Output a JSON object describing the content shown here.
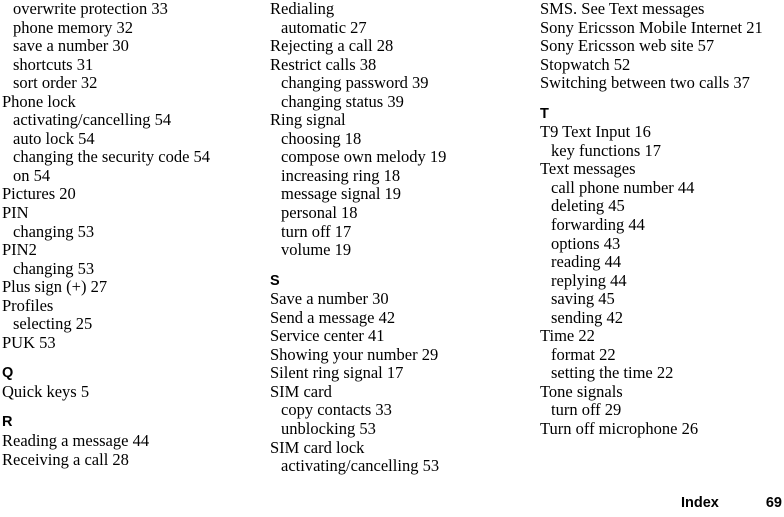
{
  "document": {
    "page_type": "index",
    "footer": {
      "label": "Index",
      "page_number": "69"
    },
    "text_color": "#000000",
    "background_color": "#ffffff"
  },
  "columns": [
    {
      "id": "column-1",
      "blocks": [
        {
          "kind": "entry",
          "level": 1,
          "text": "overwrite protection 33"
        },
        {
          "kind": "entry",
          "level": 1,
          "text": "phone memory 32"
        },
        {
          "kind": "entry",
          "level": 1,
          "text": "save a number 30"
        },
        {
          "kind": "entry",
          "level": 1,
          "text": "shortcuts 31"
        },
        {
          "kind": "entry",
          "level": 1,
          "text": "sort order 32"
        },
        {
          "kind": "entry",
          "level": 0,
          "text": "Phone lock"
        },
        {
          "kind": "entry",
          "level": 1,
          "text": "activating/cancelling 54"
        },
        {
          "kind": "entry",
          "level": 1,
          "text": "auto lock 54"
        },
        {
          "kind": "entry",
          "level": 1,
          "text": "changing the security code 54"
        },
        {
          "kind": "entry",
          "level": 1,
          "text": "on 54"
        },
        {
          "kind": "entry",
          "level": 0,
          "text": "Pictures 20"
        },
        {
          "kind": "entry",
          "level": 0,
          "text": "PIN"
        },
        {
          "kind": "entry",
          "level": 1,
          "text": "changing 53"
        },
        {
          "kind": "entry",
          "level": 0,
          "text": "PIN2"
        },
        {
          "kind": "entry",
          "level": 1,
          "text": "changing 53"
        },
        {
          "kind": "entry",
          "level": 0,
          "text": "Plus sign (+) 27"
        },
        {
          "kind": "entry",
          "level": 0,
          "text": "Profiles"
        },
        {
          "kind": "entry",
          "level": 1,
          "text": "selecting 25"
        },
        {
          "kind": "entry",
          "level": 0,
          "text": "PUK 53"
        },
        {
          "kind": "spacer"
        },
        {
          "kind": "heading",
          "text": "Q"
        },
        {
          "kind": "entry",
          "level": 0,
          "text": "Quick keys 5"
        },
        {
          "kind": "spacer"
        },
        {
          "kind": "heading",
          "text": "R"
        },
        {
          "kind": "entry",
          "level": 0,
          "text": "Reading a message 44"
        },
        {
          "kind": "entry",
          "level": 0,
          "text": "Receiving a call 28"
        }
      ]
    },
    {
      "id": "column-2",
      "blocks": [
        {
          "kind": "entry",
          "level": 0,
          "text": "Redialing"
        },
        {
          "kind": "entry",
          "level": 1,
          "text": "automatic 27"
        },
        {
          "kind": "entry",
          "level": 0,
          "text": "Rejecting a call 28"
        },
        {
          "kind": "entry",
          "level": 0,
          "text": "Restrict calls 38"
        },
        {
          "kind": "entry",
          "level": 1,
          "text": "changing password 39"
        },
        {
          "kind": "entry",
          "level": 1,
          "text": "changing status 39"
        },
        {
          "kind": "entry",
          "level": 0,
          "text": "Ring signal"
        },
        {
          "kind": "entry",
          "level": 1,
          "text": "choosing 18"
        },
        {
          "kind": "entry",
          "level": 1,
          "text": "compose own melody 19"
        },
        {
          "kind": "entry",
          "level": 1,
          "text": "increasing ring 18"
        },
        {
          "kind": "entry",
          "level": 1,
          "text": "message signal 19"
        },
        {
          "kind": "entry",
          "level": 1,
          "text": "personal 18"
        },
        {
          "kind": "entry",
          "level": 1,
          "text": "turn off 17"
        },
        {
          "kind": "entry",
          "level": 1,
          "text": "volume 19"
        },
        {
          "kind": "spacer"
        },
        {
          "kind": "heading",
          "text": "S"
        },
        {
          "kind": "entry",
          "level": 0,
          "text": "Save a number 30"
        },
        {
          "kind": "entry",
          "level": 0,
          "text": "Send a message 42"
        },
        {
          "kind": "entry",
          "level": 0,
          "text": "Service center 41"
        },
        {
          "kind": "entry",
          "level": 0,
          "text": "Showing your number 29"
        },
        {
          "kind": "entry",
          "level": 0,
          "text": "Silent ring signal 17"
        },
        {
          "kind": "entry",
          "level": 0,
          "text": "SIM card"
        },
        {
          "kind": "entry",
          "level": 1,
          "text": "copy contacts 33"
        },
        {
          "kind": "entry",
          "level": 1,
          "text": "unblocking 53"
        },
        {
          "kind": "entry",
          "level": 0,
          "text": "SIM card lock"
        },
        {
          "kind": "entry",
          "level": 1,
          "text": "activating/cancelling 53"
        }
      ]
    },
    {
      "id": "column-3",
      "blocks": [
        {
          "kind": "entry",
          "level": 0,
          "text": "SMS. See Text messages"
        },
        {
          "kind": "entry",
          "level": 0,
          "text": "Sony Ericsson Mobile Internet 21"
        },
        {
          "kind": "entry",
          "level": 0,
          "text": "Sony Ericsson web site 57"
        },
        {
          "kind": "entry",
          "level": 0,
          "text": "Stopwatch 52"
        },
        {
          "kind": "entry",
          "level": 0,
          "text": "Switching between two calls 37"
        },
        {
          "kind": "spacer"
        },
        {
          "kind": "heading",
          "text": "T"
        },
        {
          "kind": "entry",
          "level": 0,
          "text": "T9 Text Input 16"
        },
        {
          "kind": "entry",
          "level": 1,
          "text": "key functions 17"
        },
        {
          "kind": "entry",
          "level": 0,
          "text": "Text messages"
        },
        {
          "kind": "entry",
          "level": 1,
          "text": "call phone number 44"
        },
        {
          "kind": "entry",
          "level": 1,
          "text": "deleting 45"
        },
        {
          "kind": "entry",
          "level": 1,
          "text": "forwarding 44"
        },
        {
          "kind": "entry",
          "level": 1,
          "text": "options 43"
        },
        {
          "kind": "entry",
          "level": 1,
          "text": "reading 44"
        },
        {
          "kind": "entry",
          "level": 1,
          "text": "replying 44"
        },
        {
          "kind": "entry",
          "level": 1,
          "text": "saving 45"
        },
        {
          "kind": "entry",
          "level": 1,
          "text": "sending 42"
        },
        {
          "kind": "entry",
          "level": 0,
          "text": "Time 22"
        },
        {
          "kind": "entry",
          "level": 1,
          "text": "format 22"
        },
        {
          "kind": "entry",
          "level": 1,
          "text": "setting the time 22"
        },
        {
          "kind": "entry",
          "level": 0,
          "text": "Tone signals"
        },
        {
          "kind": "entry",
          "level": 1,
          "text": "turn off 29"
        },
        {
          "kind": "entry",
          "level": 0,
          "text": "Turn off microphone 26"
        }
      ]
    }
  ]
}
